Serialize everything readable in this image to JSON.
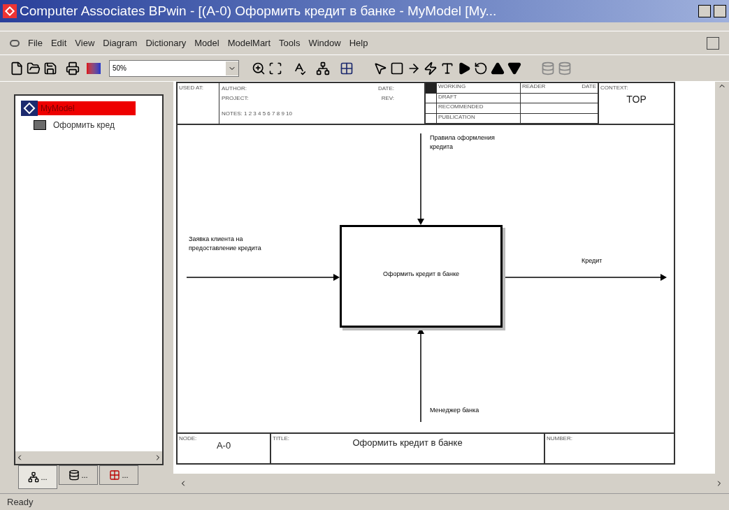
{
  "window": {
    "title": "Computer Associates BPwin - [(A-0) Оформить кредит в банке - MyModel  [My..."
  },
  "menu": [
    {
      "label": "File"
    },
    {
      "label": "Edit"
    },
    {
      "label": "View"
    },
    {
      "label": "Diagram"
    },
    {
      "label": "Dictionary"
    },
    {
      "label": "Model"
    },
    {
      "label": "ModelMart"
    },
    {
      "label": "Tools"
    },
    {
      "label": "Window"
    },
    {
      "label": "Help"
    }
  ],
  "toolbar": {
    "zoom": "50%"
  },
  "tree": [
    {
      "label": "MyModel",
      "selected": true,
      "children": [
        {
          "label": "Оформить кред",
          "selected": false
        }
      ]
    }
  ],
  "explorer_tabs": [
    {
      "label": "...",
      "selected": true
    },
    {
      "label": "...",
      "selected": false
    },
    {
      "label": "...",
      "selected": false
    }
  ],
  "diagram": {
    "header": {
      "used_at": "USED AT:",
      "author": "AUTHOR:",
      "project": "PROJECT:",
      "date": "DATE:",
      "rev": "REV:",
      "notes": "NOTES:  1  2  3  4  5  6  7  8  9  10",
      "status_rows": [
        {
          "label": "WORKING",
          "selected": true
        },
        {
          "label": "DRAFT",
          "selected": false
        },
        {
          "label": "RECOMMENDED",
          "selected": false
        },
        {
          "label": "PUBLICATION",
          "selected": false
        }
      ],
      "reader": "READER",
      "reader_date": "DATE",
      "context": "CONTEXT:",
      "context_value": "TOP"
    },
    "activity": {
      "label": "Оформить кредит в банке"
    },
    "arrows": [
      {
        "kind": "control",
        "label": "Правила оформления кредита"
      },
      {
        "kind": "input",
        "label": "Заявка клиента на предоставление кредита"
      },
      {
        "kind": "output",
        "label": "Кредит"
      },
      {
        "kind": "mechanism",
        "label": "Менеджер банка"
      }
    ],
    "footer": {
      "node_label": "NODE:",
      "node": "A-0",
      "title_label": "TITLE:",
      "title": "Оформить кредит в банке",
      "number_label": "NUMBER:"
    }
  },
  "status_bar": {
    "text": "Ready"
  }
}
